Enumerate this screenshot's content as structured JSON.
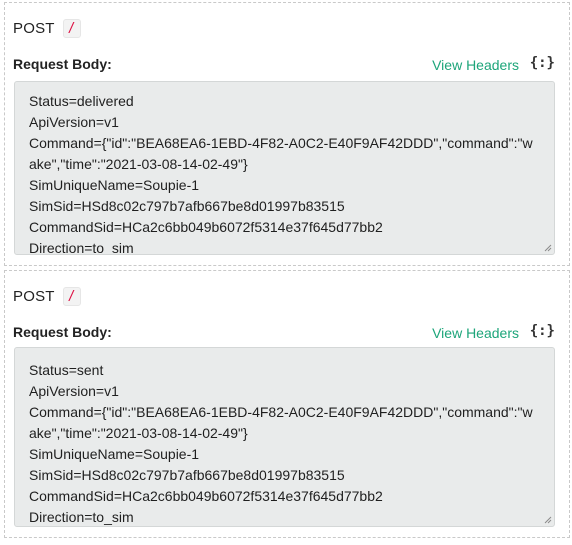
{
  "requests": [
    {
      "method": "POST",
      "path": "/",
      "body_label": "Request Body:",
      "view_headers": "View Headers",
      "json_toggle": "{:}",
      "body_lines": [
        "Status=delivered",
        "ApiVersion=v1",
        "Command={\"id\":\"BEA68EA6-1EBD-4F82-A0C2-E40F9AF42DDD\",\"command\":\"wake\",\"time\":\"2021-03-08-14-02-49\"}",
        "SimUniqueName=Soupie-1",
        "SimSid=HSd8c02c797b7afb667be8d01997b83515",
        "CommandSid=HCa2c6bb049b6072f5314e37f645d77bb2",
        "Direction=to_sim"
      ]
    },
    {
      "method": "POST",
      "path": "/",
      "body_label": "Request Body:",
      "view_headers": "View Headers",
      "json_toggle": "{:}",
      "body_lines": [
        "Status=sent",
        "ApiVersion=v1",
        "Command={\"id\":\"BEA68EA6-1EBD-4F82-A0C2-E40F9AF42DDD\",\"command\":\"wake\",\"time\":\"2021-03-08-14-02-49\"}",
        "SimUniqueName=Soupie-1",
        "SimSid=HSd8c02c797b7afb667be8d01997b83515",
        "CommandSid=HCa2c6bb049b6072f5314e37f645d77bb2",
        "Direction=to_sim"
      ]
    }
  ]
}
